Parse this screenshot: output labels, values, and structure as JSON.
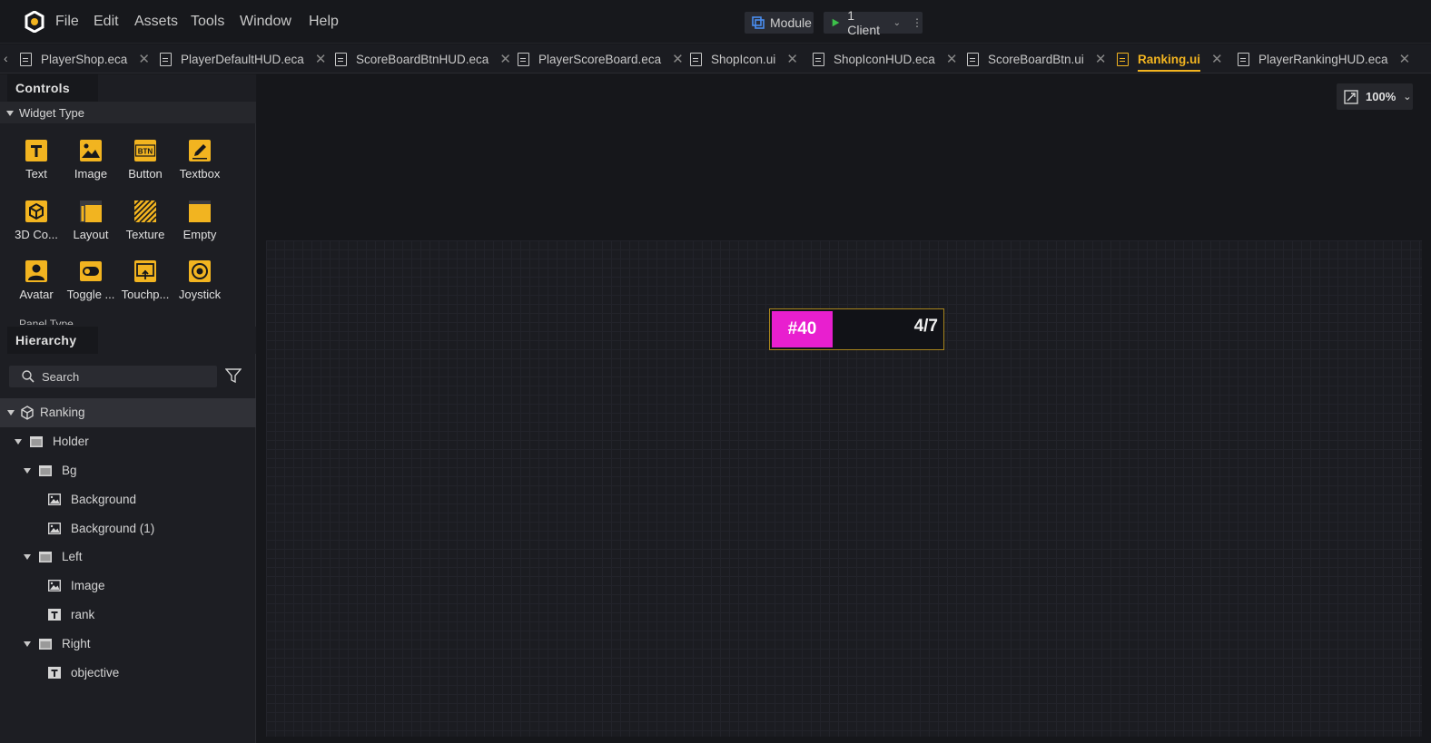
{
  "menu": {
    "items": [
      "File",
      "Edit",
      "Assets",
      "Tools",
      "Window",
      "Help"
    ]
  },
  "toolbar": {
    "module_label": "Module",
    "client_label": "1 Client"
  },
  "tabs": [
    {
      "label": "PlayerShop.eca",
      "active": false
    },
    {
      "label": "PlayerDefaultHUD.eca",
      "active": false
    },
    {
      "label": "ScoreBoardBtnHUD.eca",
      "active": false
    },
    {
      "label": "PlayerScoreBoard.eca",
      "active": false
    },
    {
      "label": "ShopIcon.ui",
      "active": false
    },
    {
      "label": "ShopIconHUD.eca",
      "active": false
    },
    {
      "label": "ScoreBoardBtn.ui",
      "active": false
    },
    {
      "label": "Ranking.ui",
      "active": true
    },
    {
      "label": "PlayerRankingHUD.eca",
      "active": false
    }
  ],
  "controls": {
    "header": "Controls",
    "widget_type_label": "Widget Type",
    "widgets": [
      {
        "label": "Text",
        "icon": "text-icon"
      },
      {
        "label": "Image",
        "icon": "image-icon"
      },
      {
        "label": "Button",
        "icon": "button-icon",
        "badge": "BTN"
      },
      {
        "label": "Textbox",
        "icon": "textbox-icon"
      },
      {
        "label": "3D Co...",
        "icon": "3d-cube-icon"
      },
      {
        "label": "Layout",
        "icon": "layout-icon"
      },
      {
        "label": "Texture",
        "icon": "texture-icon"
      },
      {
        "label": "Empty",
        "icon": "empty-icon"
      },
      {
        "label": "Avatar",
        "icon": "avatar-icon"
      },
      {
        "label": "Toggle ...",
        "icon": "toggle-icon"
      },
      {
        "label": "Touchp...",
        "icon": "touchpad-icon"
      },
      {
        "label": "Joystick",
        "icon": "joystick-icon"
      }
    ],
    "panel_type_label": "Panel Type"
  },
  "hierarchy": {
    "header": "Hierarchy",
    "search_placeholder": "Search",
    "nodes": [
      {
        "label": "Ranking",
        "type": "root"
      },
      {
        "label": "Holder",
        "type": "folder"
      },
      {
        "label": "Bg",
        "type": "folder"
      },
      {
        "label": "Background",
        "type": "image"
      },
      {
        "label": "Background (1)",
        "type": "image"
      },
      {
        "label": "Left",
        "type": "folder"
      },
      {
        "label": "Image",
        "type": "image"
      },
      {
        "label": "rank",
        "type": "text"
      },
      {
        "label": "Right",
        "type": "folder"
      },
      {
        "label": "objective",
        "type": "text"
      }
    ]
  },
  "canvas": {
    "zoom": "100%",
    "preview": {
      "rank_text": "#40",
      "objective_text": "4/7",
      "rank_color": "#e81fcf",
      "border_color": "#a7841c"
    }
  },
  "colors": {
    "accent": "#f2b420",
    "play": "#3cc14a",
    "module_icon": "#4a8ef0"
  }
}
